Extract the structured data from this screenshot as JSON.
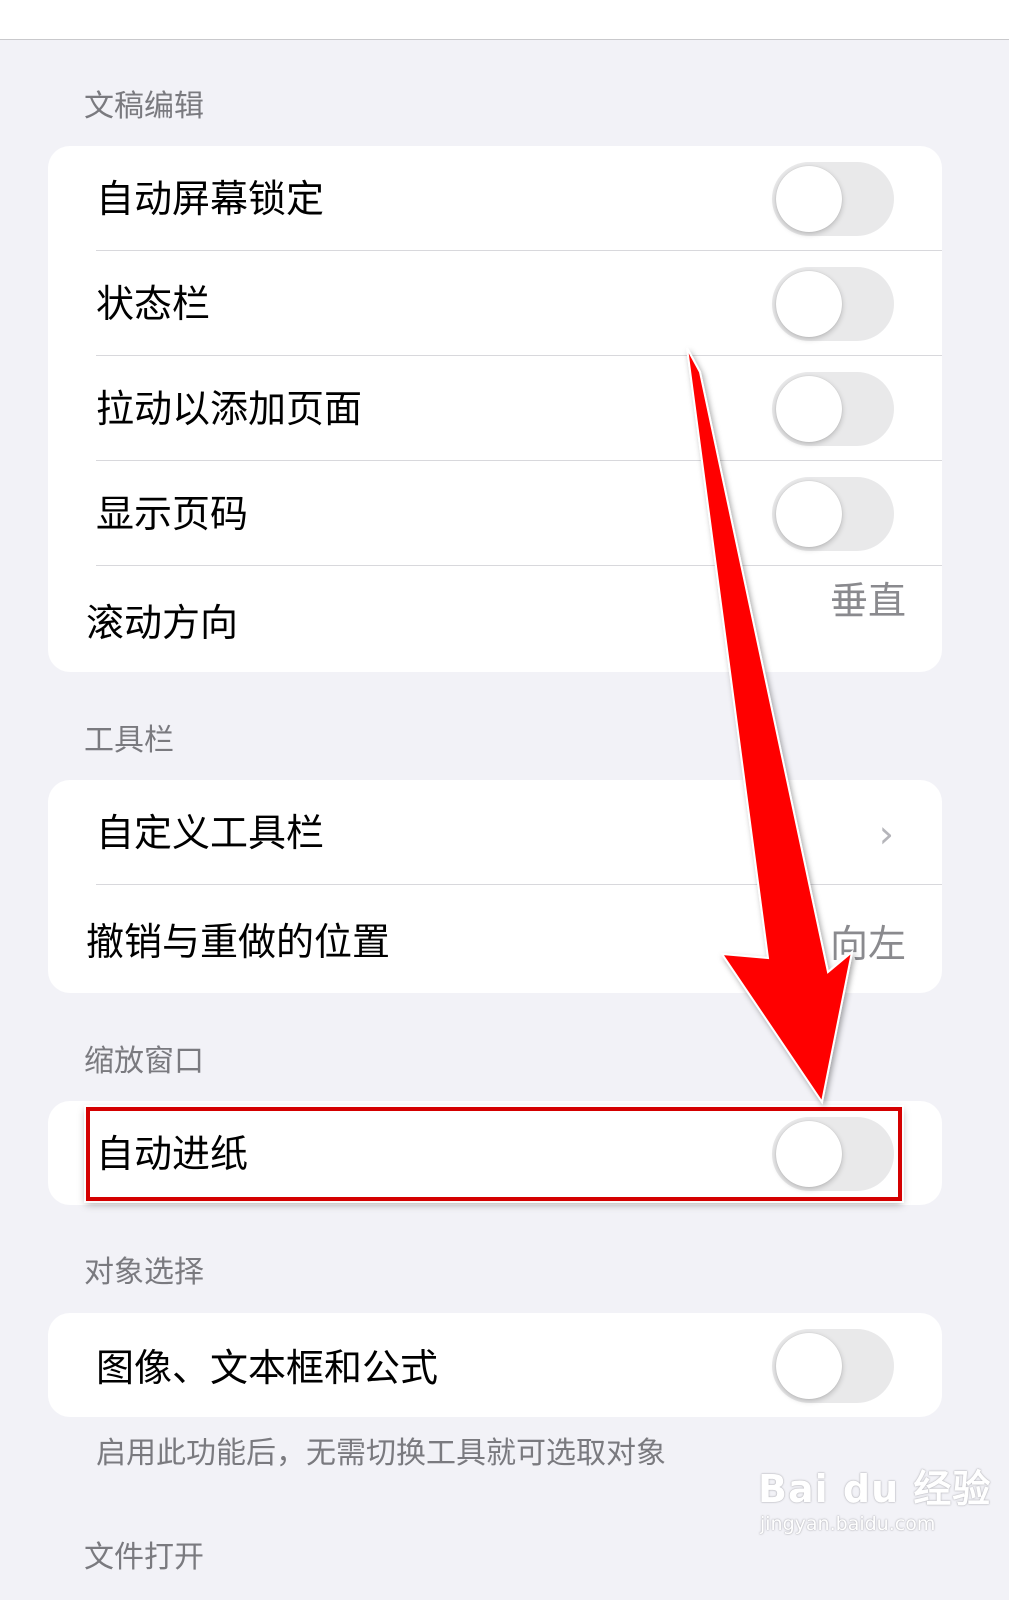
{
  "sections": {
    "editing": {
      "title": "文稿编辑",
      "rows": [
        {
          "label": "自动屏幕锁定",
          "toggle": false
        },
        {
          "label": "状态栏",
          "toggle": false
        },
        {
          "label": "拉动以添加页面",
          "toggle": false
        },
        {
          "label": "显示页码",
          "toggle": false
        },
        {
          "label": "滚动方向",
          "value": "垂直"
        }
      ]
    },
    "toolbar": {
      "title": "工具栏",
      "rows": [
        {
          "label": "自定义工具栏",
          "chevron": "›"
        },
        {
          "label": "撤销与重做的位置",
          "value": "向左"
        }
      ]
    },
    "zoom": {
      "title": "缩放窗口",
      "rows": [
        {
          "label": "自动进纸",
          "toggle": false
        }
      ]
    },
    "selection": {
      "title": "对象选择",
      "rows": [
        {
          "label": "图像、文本框和公式",
          "toggle": false
        }
      ],
      "footnote": "启用此功能后，无需切换工具就可选取对象"
    },
    "file_open": {
      "title": "文件打开"
    }
  },
  "annotation": {
    "arrow_color": "#ff0000",
    "highlight_color": "#d40000"
  },
  "watermark": {
    "brand": "Bai du 经验",
    "url": "jingyan.baidu.com"
  }
}
